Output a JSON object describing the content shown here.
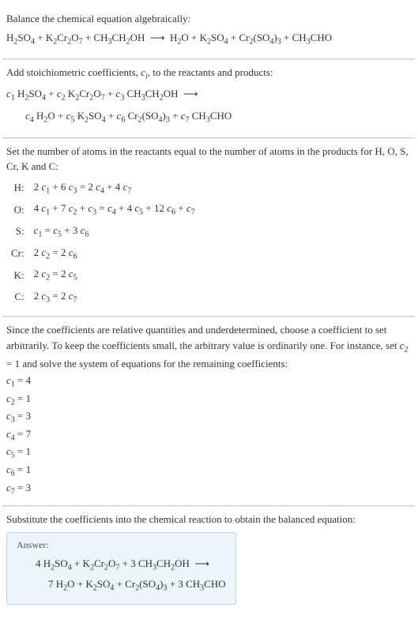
{
  "s1": {
    "intro": "Balance the chemical equation algebraically:",
    "eq": "H<sub>2</sub>SO<sub>4</sub> + K<sub>2</sub>Cr<sub>2</sub>O<sub>7</sub> + CH<sub>3</sub>CH<sub>2</sub>OH &nbsp;⟶&nbsp; H<sub>2</sub>O + K<sub>2</sub>SO<sub>4</sub> + Cr<sub>2</sub>(SO<sub>4</sub>)<sub>3</sub> + CH<sub>3</sub>CHO"
  },
  "s2": {
    "intro": "Add stoichiometric coefficients, <span class='ci'>c<sub>i</sub></span>, to the reactants and products:",
    "eq1": "<span class='ci'>c</span><sub>1</sub> H<sub>2</sub>SO<sub>4</sub> + <span class='ci'>c</span><sub>2</sub> K<sub>2</sub>Cr<sub>2</sub>O<sub>7</sub> + <span class='ci'>c</span><sub>3</sub> CH<sub>3</sub>CH<sub>2</sub>OH &nbsp;⟶",
    "eq2": "<span class='ci'>c</span><sub>4</sub> H<sub>2</sub>O + <span class='ci'>c</span><sub>5</sub> K<sub>2</sub>SO<sub>4</sub> + <span class='ci'>c</span><sub>6</sub> Cr<sub>2</sub>(SO<sub>4</sub>)<sub>3</sub> + <span class='ci'>c</span><sub>7</sub> CH<sub>3</sub>CHO"
  },
  "s3": {
    "intro": "Set the number of atoms in the reactants equal to the number of atoms in the products for H, O, S, Cr, K and C:",
    "rows": [
      {
        "el": "H:",
        "eq": "2 <span class='ci'>c</span><sub>1</sub> + 6 <span class='ci'>c</span><sub>3</sub> = 2 <span class='ci'>c</span><sub>4</sub> + 4 <span class='ci'>c</span><sub>7</sub>"
      },
      {
        "el": "O:",
        "eq": "4 <span class='ci'>c</span><sub>1</sub> + 7 <span class='ci'>c</span><sub>2</sub> + <span class='ci'>c</span><sub>3</sub> = <span class='ci'>c</span><sub>4</sub> + 4 <span class='ci'>c</span><sub>5</sub> + 12 <span class='ci'>c</span><sub>6</sub> + <span class='ci'>c</span><sub>7</sub>"
      },
      {
        "el": "S:",
        "eq": "<span class='ci'>c</span><sub>1</sub> = <span class='ci'>c</span><sub>5</sub> + 3 <span class='ci'>c</span><sub>6</sub>"
      },
      {
        "el": "Cr:",
        "eq": "2 <span class='ci'>c</span><sub>2</sub> = 2 <span class='ci'>c</span><sub>6</sub>"
      },
      {
        "el": "K:",
        "eq": "2 <span class='ci'>c</span><sub>2</sub> = 2 <span class='ci'>c</span><sub>5</sub>"
      },
      {
        "el": "C:",
        "eq": "2 <span class='ci'>c</span><sub>3</sub> = 2 <span class='ci'>c</span><sub>7</sub>"
      }
    ]
  },
  "s4": {
    "intro": "Since the coefficients are relative quantities and underdetermined, choose a coefficient to set arbitrarily. To keep the coefficients small, the arbitrary value is ordinarily one. For instance, set <span class='ci'>c</span><sub>2</sub> = 1 and solve the system of equations for the remaining coefficients:",
    "coefs": [
      "<span class='ci'>c</span><sub>1</sub> = 4",
      "<span class='ci'>c</span><sub>2</sub> = 1",
      "<span class='ci'>c</span><sub>3</sub> = 3",
      "<span class='ci'>c</span><sub>4</sub> = 7",
      "<span class='ci'>c</span><sub>5</sub> = 1",
      "<span class='ci'>c</span><sub>6</sub> = 1",
      "<span class='ci'>c</span><sub>7</sub> = 3"
    ]
  },
  "s5": {
    "intro": "Substitute the coefficients into the chemical reaction to obtain the balanced equation:",
    "answer_label": "Answer:",
    "answer1": "4 H<sub>2</sub>SO<sub>4</sub> + K<sub>2</sub>Cr<sub>2</sub>O<sub>7</sub> + 3 CH<sub>3</sub>CH<sub>2</sub>OH &nbsp;⟶",
    "answer2": "7 H<sub>2</sub>O + K<sub>2</sub>SO<sub>4</sub> + Cr<sub>2</sub>(SO<sub>4</sub>)<sub>3</sub> + 3 CH<sub>3</sub>CHO"
  }
}
